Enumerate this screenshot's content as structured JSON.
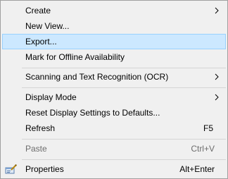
{
  "menu": {
    "items": [
      {
        "label": "Create",
        "submenu": true
      },
      {
        "label": "New View..."
      },
      {
        "label": "Export...",
        "highlighted": true
      },
      {
        "label": "Mark for Offline Availability"
      },
      {
        "label": "Scanning and Text Recognition (OCR)",
        "submenu": true
      },
      {
        "label": "Display Mode",
        "submenu": true
      },
      {
        "label": "Reset Display Settings to Defaults..."
      },
      {
        "label": "Refresh",
        "shortcut": "F5"
      },
      {
        "label": "Paste",
        "shortcut": "Ctrl+V",
        "disabled": true
      },
      {
        "label": "Properties",
        "shortcut": "Alt+Enter",
        "icon": "properties-icon"
      }
    ]
  },
  "colors": {
    "background": "#f0f0f0",
    "highlight_fill": "#cce8ff",
    "highlight_border": "#99d1ff",
    "disabled_text": "#6d6d6d",
    "separator": "#d5d5d5"
  }
}
